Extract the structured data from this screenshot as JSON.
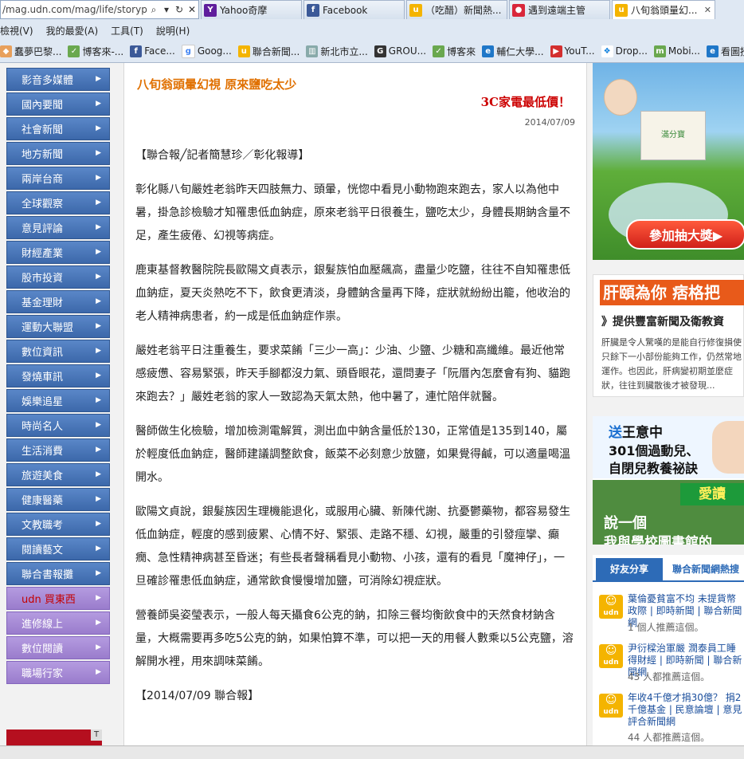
{
  "browser": {
    "address_url": "/mag.udn.com/mag/life/storypage",
    "tabs": [
      {
        "label": "Yahoo奇摩",
        "icon": "yahoo-icon",
        "color": "#5f1d9c"
      },
      {
        "label": "Facebook",
        "icon": "facebook-icon",
        "color": "#3b5998"
      },
      {
        "label": "（吃醋）新聞熱...",
        "icon": "udn-icon",
        "color": "#f4b400"
      },
      {
        "label": "遇到遠端主管",
        "icon": "strawberry-icon",
        "color": "#d9263a"
      },
      {
        "label": "八旬翁頭量幻...",
        "icon": "udn-icon",
        "color": "#f4b400",
        "active": true
      }
    ],
    "menu": [
      "檢視(V)",
      "我的最愛(A)",
      "工具(T)",
      "說明(H)"
    ],
    "bookmarks": [
      {
        "label": "蠢夢巴黎...",
        "icon": "cake-icon"
      },
      {
        "label": "博客來-...",
        "icon": "bookstore-icon"
      },
      {
        "label": "Face...",
        "icon": "facebook-icon"
      },
      {
        "label": "Goog...",
        "icon": "google-icon"
      },
      {
        "label": "聯合新聞...",
        "icon": "udn-icon"
      },
      {
        "label": "新北市立...",
        "icon": "library-icon"
      },
      {
        "label": "GROU...",
        "icon": "groupon-icon"
      },
      {
        "label": "博客來",
        "icon": "bookstore-icon"
      },
      {
        "label": "輔仁大學...",
        "icon": "ie-icon"
      },
      {
        "label": "YouT...",
        "icon": "youtube-icon"
      },
      {
        "label": "Drop...",
        "icon": "dropbox-icon"
      },
      {
        "label": "Mobi...",
        "icon": "mobile01-icon"
      },
      {
        "label": "看圖授...",
        "icon": "ie-icon"
      }
    ]
  },
  "nav": {
    "items": [
      {
        "label": "影音多媒體",
        "style": "blue"
      },
      {
        "label": "國內要聞",
        "style": "blue"
      },
      {
        "label": "社會新聞",
        "style": "blue"
      },
      {
        "label": "地方新聞",
        "style": "blue"
      },
      {
        "label": "兩岸台商",
        "style": "blue"
      },
      {
        "label": "全球觀察",
        "style": "blue"
      },
      {
        "label": "意見評論",
        "style": "blue"
      },
      {
        "label": "財經產業",
        "style": "blue"
      },
      {
        "label": "股市投資",
        "style": "blue"
      },
      {
        "label": "基金理財",
        "style": "blue"
      },
      {
        "label": "運動大聯盟",
        "style": "blue"
      },
      {
        "label": "數位資訊",
        "style": "blue"
      },
      {
        "label": "發燒車訊",
        "style": "blue"
      },
      {
        "label": "娛樂追星",
        "style": "blue"
      },
      {
        "label": "時尚名人",
        "style": "blue"
      },
      {
        "label": "生活消費",
        "style": "blue"
      },
      {
        "label": "旅遊美食",
        "style": "blue"
      },
      {
        "label": "健康醫藥",
        "style": "blue"
      },
      {
        "label": "文教職考",
        "style": "blue"
      },
      {
        "label": "閱讀藝文",
        "style": "blue"
      },
      {
        "label": "聯合書報攤",
        "style": "blue"
      },
      {
        "label": "udn 買東西",
        "style": "purple-udn"
      },
      {
        "label": "進修線上",
        "style": "purple"
      },
      {
        "label": "數位閱讀",
        "style": "purple"
      },
      {
        "label": "職場行家",
        "style": "purple"
      }
    ],
    "corner_label": "T"
  },
  "article": {
    "title": "八旬翁頭暈幻視 原來鹽吃太少",
    "ad_link": "3C家電最低價！",
    "date": "2014/07/09",
    "paragraphs": [
      "【聯合報╱記者簡慧珍／彰化報導】",
      "彰化縣八旬嚴姓老翁昨天四肢無力、頭暈，恍惚中看見小動物跑來跑去，家人以為他中暑，掛急診檢驗才知罹患低血鈉症，原來老翁平日很養生，鹽吃太少，身體長期鈉含量不足，產生疲倦、幻視等病症。",
      "鹿東基督教醫院院長歐陽文貞表示，銀髮族怕血壓飆高，盡量少吃鹽，往往不自知罹患低血鈉症，夏天炎熱吃不下，飲食更清淡，身體鈉含量再下降，症狀就紛紛出籠，他收治的老人精神病患者，約一成是低血鈉症作祟。",
      "嚴姓老翁平日注重養生，要求菜餚「三少一高」：少油、少鹽、少糖和高纖維。最近他常感疲憊、容易緊張，昨天手腳都沒力氣、頭昏眼花，還問妻子「阮厝內怎麼會有狗、貓跑來跑去？」嚴姓老翁的家人一致認為天氣太熱，他中暑了，連忙陪伴就醫。",
      "醫師做生化檢驗，增加檢測電解質，測出血中鈉含量低於130，正常值是135到140，屬於輕度低血鈉症，醫師建議調整飲食，飯菜不必刻意少放鹽，如果覺得鹹，可以適量喝溫開水。",
      "歐陽文貞說，銀髮族因生理機能退化，或服用心臟、新陳代謝、抗憂鬱藥物，都容易發生低血鈉症，輕度的感到疲累、心情不好、緊張、走路不穩、幻視，嚴重的引發痙攣、癲癇、急性精神病甚至昏迷；有些長者聲稱看見小動物、小孩，還有的看見「魔神仔」，一旦確診罹患低血鈉症，通常飲食慢慢增加鹽，可消除幻視症狀。",
      "營養師吳姿瑩表示，一般人每天攝食6公克的鈉，扣除三餐均衡飲食中的天然食材鈉含量，大概需要再多吃5公克的鈉，如果怕算不準，可以把一天的用餐人數乘以5公克鹽，溶解開水裡，用來調味菜餚。",
      "【2014/07/09 聯合報】"
    ]
  },
  "right": {
    "ad1": {
      "box_label": "滿分寶",
      "button": "參加抽大獎▶"
    },
    "ad2": {
      "headline": "肝頤為你 痞格把",
      "sub": "》提供豐富新聞及衛教資",
      "text": "肝臟是令人驚嘆的是能自行修復損使只餘下一小部份能夠工作，仍然常地運作。也因此，肝病變初期並麼症狀，往往到臟散後才被發現..."
    },
    "ad3": {
      "line1_hl": "送",
      "line1": "王意中",
      "line2": "301個過動兒、",
      "line3": "自閉兒教養祕訣",
      "pill": "愛讀",
      "line4": "說一個",
      "line5": "我與學校圖書館的"
    },
    "share": {
      "tab1": "好友分享",
      "tab2": "聯合新聞網熱搜",
      "logo_text": "udn",
      "items": [
        {
          "title": "葉倫憂貧富不均 未提貨幣政際 | 即時新聞 | 聯合新聞網",
          "count": "1 個人推薦這個。"
        },
        {
          "title": "尹衍樑治軍嚴 潤泰員工睡得財經 | 即時新聞 | 聯合新聞網",
          "count": "43 人都推薦這個。"
        },
        {
          "title": "年收4千億才捐30億？ 捐2千億基金 | 民意論壇 | 意見評合新聞網",
          "count": "44 人都推薦這個。"
        }
      ]
    }
  }
}
